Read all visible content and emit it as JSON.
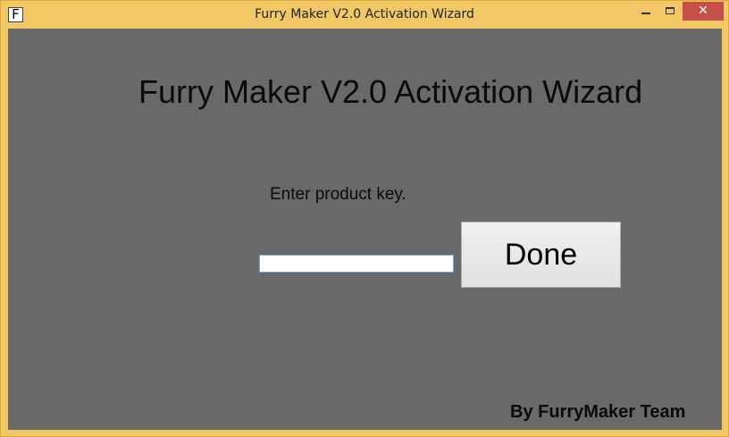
{
  "window": {
    "title": "Furry Maker V2.0 Activation Wizard",
    "icon_letter": "F",
    "controls": {
      "minimize": "minimize-icon",
      "maximize": "maximize-icon",
      "close": "close-icon",
      "close_glyph": "✕"
    }
  },
  "main": {
    "heading": "Furry Maker V2.0 Activation Wizard",
    "prompt": "Enter product key.",
    "product_key": {
      "value": "",
      "placeholder": ""
    },
    "done_label": "Done",
    "credit": "By FurryMaker Team"
  },
  "colors": {
    "frame": "#f2c866",
    "client_background": "#696969",
    "close_button": "#c74f4a",
    "input_border": "#7aa7d4"
  }
}
